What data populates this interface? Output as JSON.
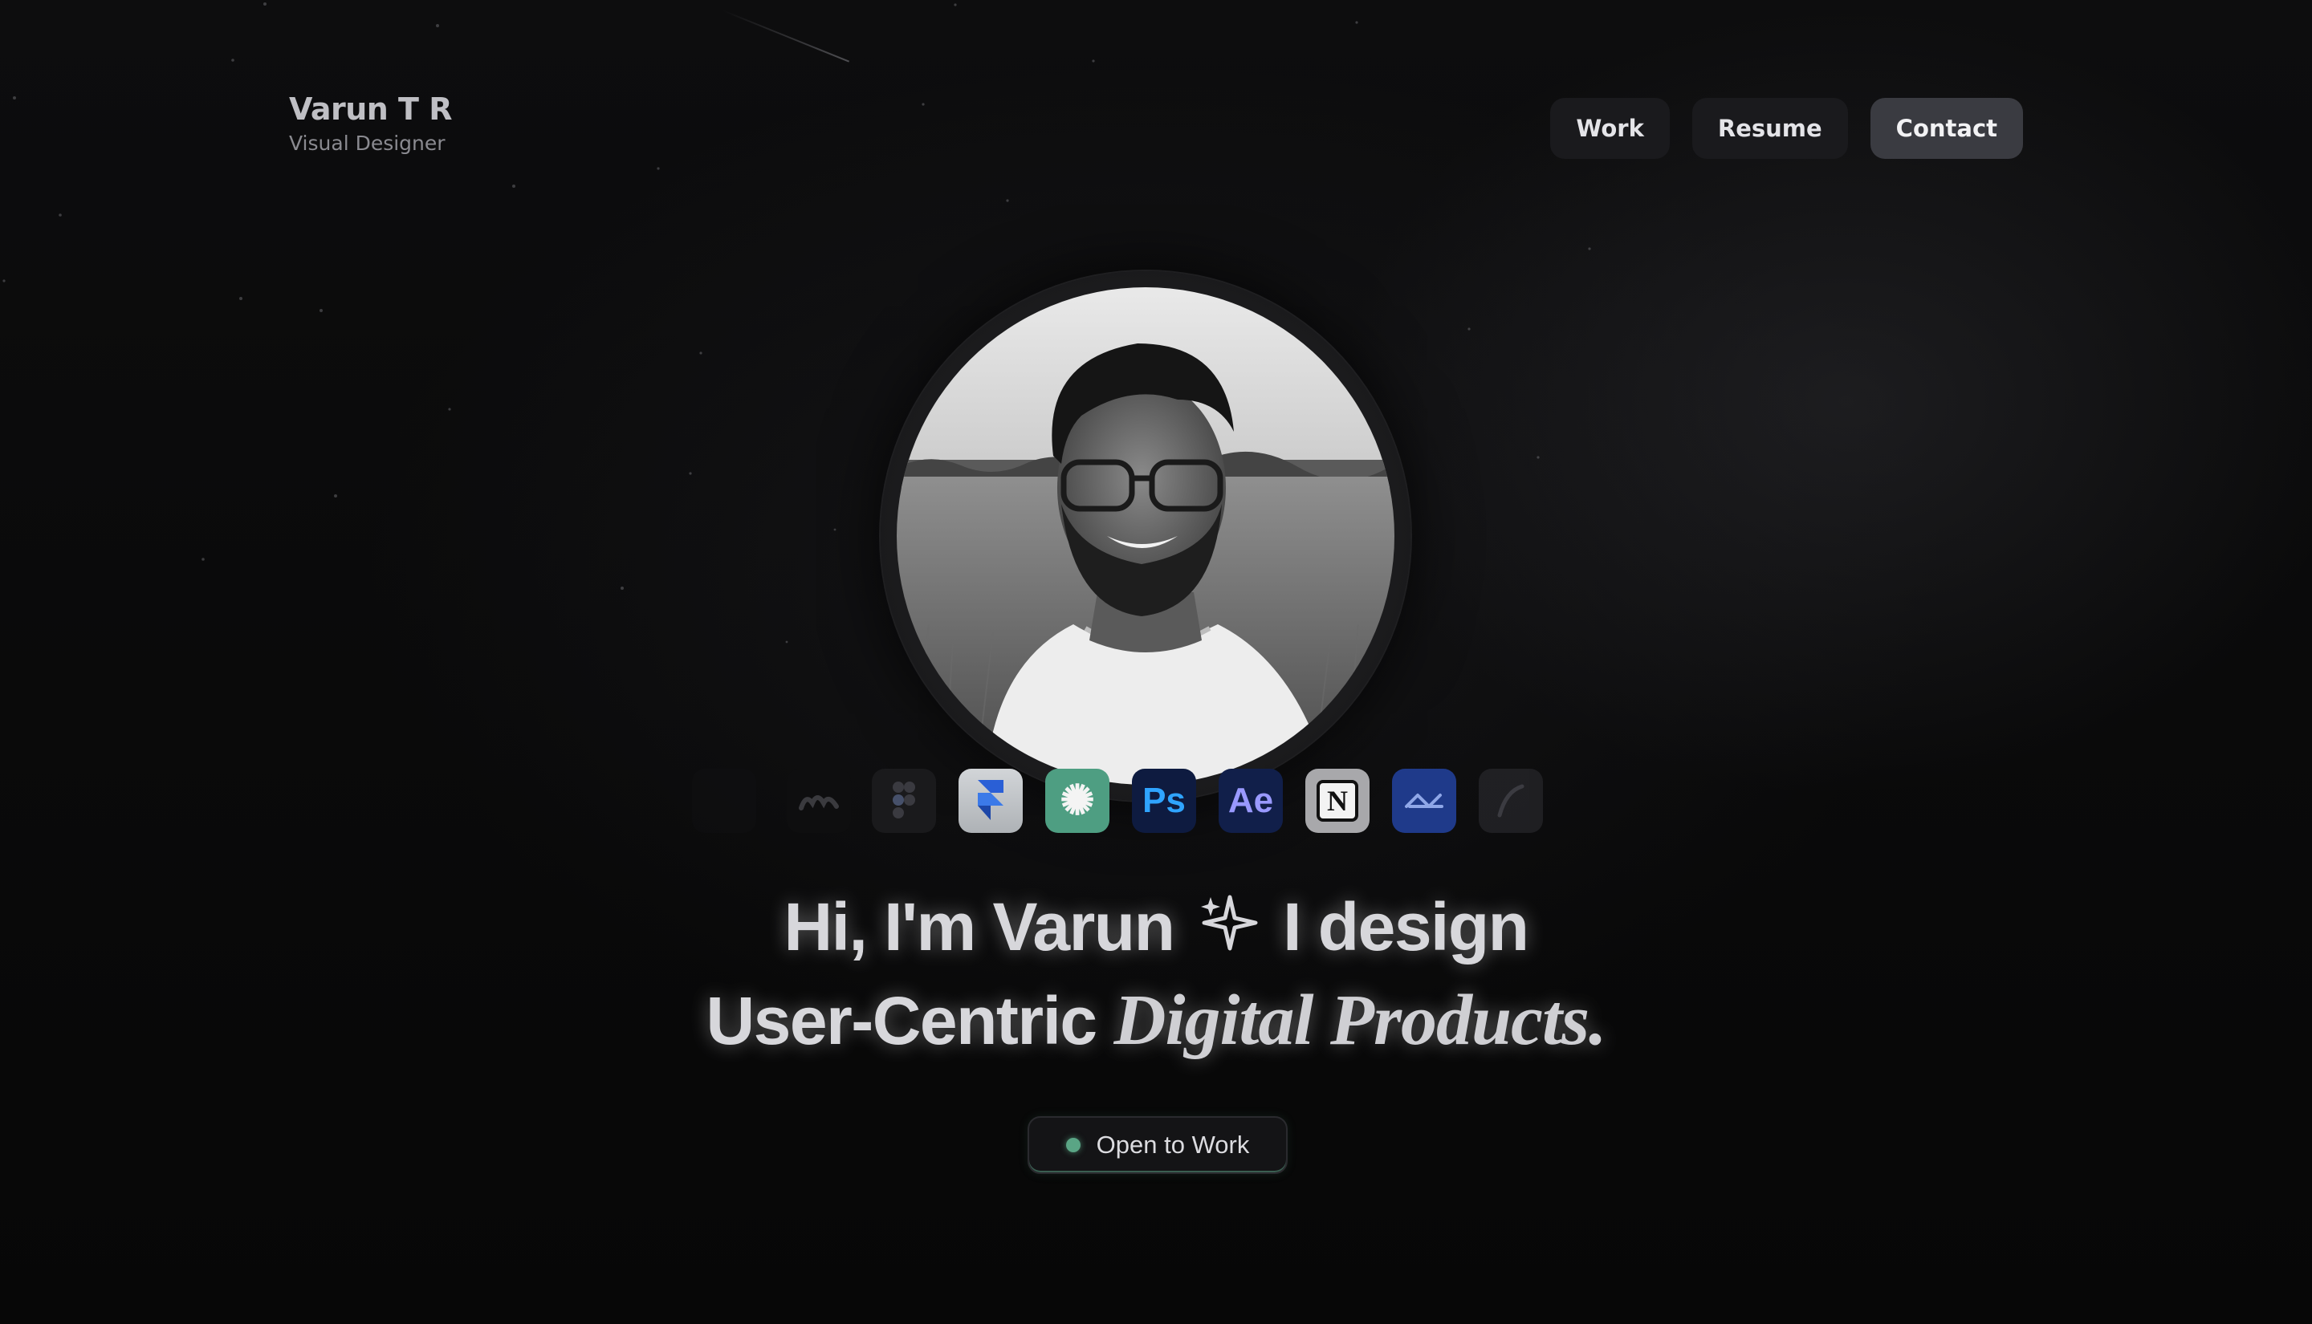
{
  "brand": {
    "name": "Varun T R",
    "role": "Visual Designer"
  },
  "nav": {
    "items": [
      {
        "label": "Work"
      },
      {
        "label": "Resume"
      },
      {
        "label": "Contact"
      }
    ],
    "active": "Contact"
  },
  "hero": {
    "greeting_part1": "Hi, I'm Varun",
    "sparkle_icon": "sparkles-icon",
    "greeting_part2": "I design",
    "line2_sans": "User-Centric",
    "line2_serif": "Digital Products."
  },
  "tools": [
    {
      "icon": "faded-tool-icon",
      "color": "#151517"
    },
    {
      "icon": "miro-like-icon",
      "color": "#0f0f10"
    },
    {
      "icon": "figma-icon",
      "color": "#1a1a1c"
    },
    {
      "icon": "framer-icon",
      "color": "#bfc3c7"
    },
    {
      "icon": "chatgpt-icon",
      "color": "#4e9e82",
      "glyph": "✺"
    },
    {
      "icon": "photoshop-icon",
      "color": "#0e1b40",
      "glyph": "Ps"
    },
    {
      "icon": "after-effects-icon",
      "color": "#111f4a",
      "glyph": "Ae"
    },
    {
      "icon": "notion-icon",
      "color": "#a8a8ab",
      "glyph": "N"
    },
    {
      "icon": "ui-infinity-icon",
      "color": "#1f3a8a"
    },
    {
      "icon": "curve-tool-icon",
      "color": "#2a2a2e"
    }
  ],
  "status": {
    "label": "Open to Work",
    "dot_color": "#5aa585"
  }
}
